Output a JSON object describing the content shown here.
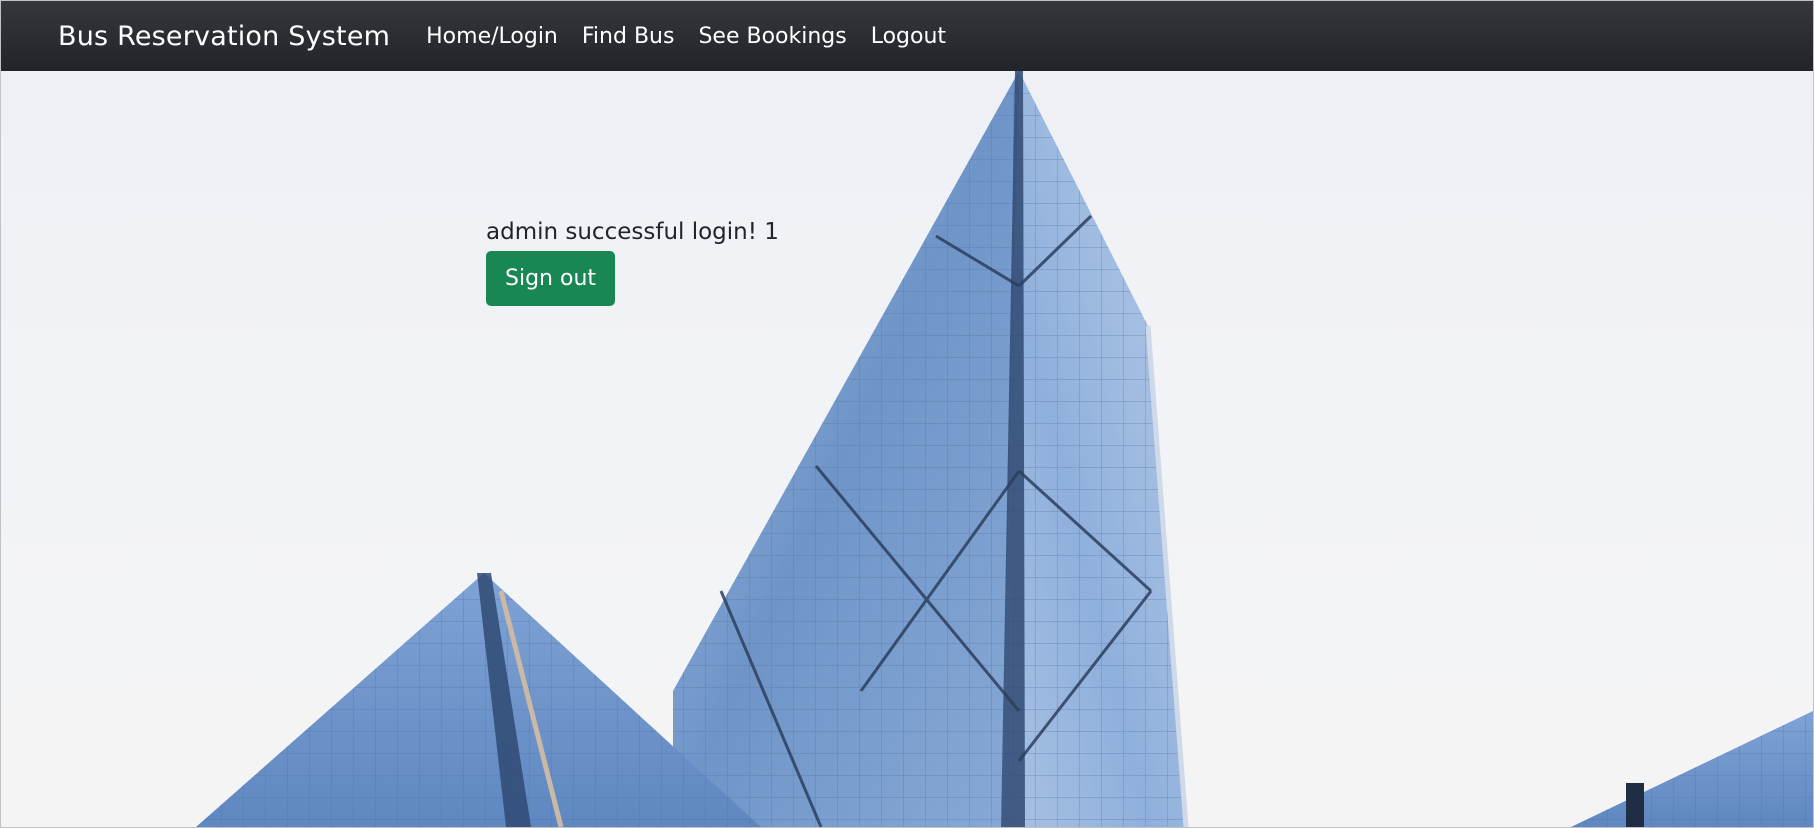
{
  "navbar": {
    "brand": "Bus Reservation System",
    "links": [
      {
        "label": "Home/Login"
      },
      {
        "label": "Find Bus"
      },
      {
        "label": "See Bookings"
      },
      {
        "label": "Logout"
      }
    ]
  },
  "main": {
    "message": "admin successful login! 1",
    "signout_label": "Sign out"
  },
  "colors": {
    "navbar": "#212529",
    "button": "#198754",
    "text": "#212529"
  },
  "background_image": "glass-skyscraper-photo"
}
